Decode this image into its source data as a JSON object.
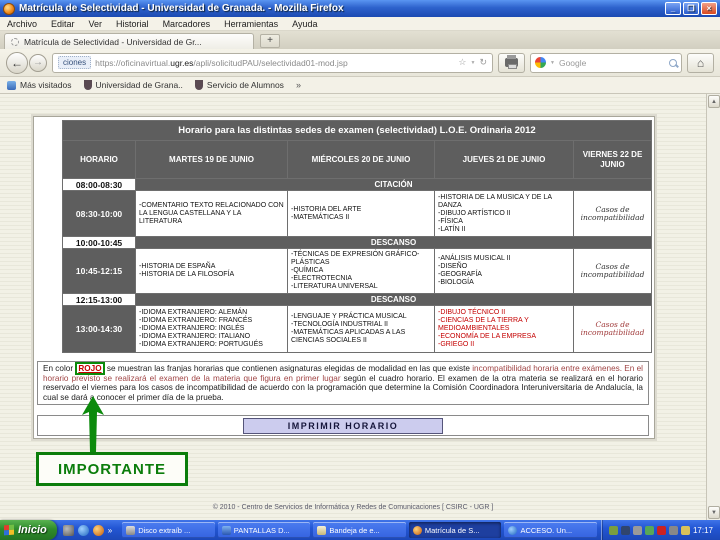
{
  "window": {
    "title": "Matrícula de Selectividad - Universidad de Granada. - Mozilla Firefox"
  },
  "menu": {
    "items": [
      "Archivo",
      "Editar",
      "Ver",
      "Historial",
      "Marcadores",
      "Herramientas",
      "Ayuda"
    ]
  },
  "tab": {
    "title": "Matrícula de Selectividad - Universidad de Gr..."
  },
  "nav": {
    "identity": "ciones",
    "url_prefix": "https://oficinavirtual.",
    "url_domain": "ugr.es",
    "url_path": "/apli/solicitudPAU/selectividad01-mod.jsp",
    "search_placeholder": "Google"
  },
  "bookmarks": {
    "items": [
      "Más visitados",
      "Universidad de Grana..",
      "Servicio de Alumnos"
    ]
  },
  "icons": {
    "back": "←",
    "forward": "→",
    "reload": "↻",
    "star": "☆",
    "caret": "▼",
    "home": "⌂",
    "new_tab": "+",
    "overflow": "»",
    "minimize": "_",
    "restore": "❐",
    "close": "×",
    "scroll_up": "▲",
    "scroll_down": "▼"
  },
  "schedule": {
    "title": "Horario para las distintas sedes de examen (selectividad) L.O.E. Ordinaria 2012",
    "headers": [
      "HORARIO",
      "MARTES 19 DE JUNIO",
      "MIÉRCOLES 20 DE JUNIO",
      "JUEVES 21 DE JUNIO",
      "VIERNES 22 DE JUNIO"
    ],
    "citacion": {
      "time": "08:00-08:30",
      "label": "CITACIÓN"
    },
    "slot1": {
      "time": "08:30-10:00",
      "martes": "-COMENTARIO TEXTO RELACIONADO CON LA LENGUA CASTELLANA Y LA LITERATURA",
      "miercoles": "-HISTORIA DEL ARTE\n-MATEMÁTICAS II",
      "jueves": "-HISTORIA DE LA MUSICA Y DE LA DANZA\n-DIBUJO ARTÍSTICO II\n-FÍSICA\n-LATÍN II",
      "viernes": "Casos de\nincompatibilidad"
    },
    "descanso1": {
      "time": "10:00-10:45",
      "label": "DESCANSO"
    },
    "slot2": {
      "time": "10:45-12:15",
      "martes": "-HISTORIA DE ESPAÑA\n-HISTORIA DE LA FILOSOFÍA",
      "miercoles": "-TÉCNICAS DE EXPRESIÓN GRÁFICO-PLÁSTICAS\n-QUÍMICA\n-ELECTROTECNIA\n-LITERATURA UNIVERSAL",
      "jueves": "-ANÁLISIS MUSICAL II\n-DISEÑO\n-GEOGRAFÍA\n-BIOLOGÍA",
      "viernes": "Casos de\nincompatibilidad"
    },
    "descanso2": {
      "time": "12:15-13:00",
      "label": "DESCANSO"
    },
    "slot3": {
      "time": "13:00-14:30",
      "martes": "-IDIOMA EXTRANJERO: ALEMÁN\n-IDIOMA EXTRANJERO: FRANCÉS\n-IDIOMA EXTRANJERO: INGLÉS\n-IDIOMA EXTRANJERO: ITALIANO\n-IDIOMA EXTRANJERO: PORTUGUÉS",
      "miercoles": "-LENGUAJE Y PRÁCTICA MUSICAL\n-TECNOLOGÍA INDUSTRIAL II\n-MATEMÁTICAS APLICADAS A LAS CIENCIAS SOCIALES II",
      "jueves": "-DIBUJO TÉCNICO II\n-CIENCIAS DE LA TIERRA Y MEDIOAMBIENTALES\n-ECONOMÍA DE LA EMPRESA\n-GRIEGO II",
      "viernes": "Casos de\nincompatibilidad"
    }
  },
  "note": {
    "seg1": "En color ",
    "rojo": "ROJO",
    "seg2": " se muestran las franjas horarias que contienen asignaturas elegidas de modalidad en las que existe ",
    "seg3": "incompatibilidad horaria entre exámenes. En el horario previsto se realizará el examen de la materia que figura en primer lugar ",
    "seg4": "según el cuadro horario. El examen de la otra materia se realizará en el horario reservado el viernes para los casos de incompatibilidad de acuerdo con la programación que determine la Comisión Coordinadora Interuniversitaria de Andalucía, la cual se dará a conocer el primer día de la prueba."
  },
  "print_button": "IMPRIMIR HORARIO",
  "annotation": {
    "importante": "IMPORTANTE"
  },
  "footer": "© 2010 - Centro de Servicios de Informática y Redes de Comunicaciones [ CSIRC - UGR ]",
  "taskbar": {
    "start": "Inicio",
    "tasks": [
      "Disco extraíb ...",
      "PANTALLAS D...",
      "Bandeja de e...",
      "Matrícula de S...",
      "ACCESO. Un..."
    ],
    "clock": "17:17"
  },
  "colors": {
    "red": "#c40000",
    "green": "#0b7d0b",
    "header_gray": "#5e5e5e",
    "button_lavender": "#ccccee",
    "taskbar_blue": "#2356d4"
  }
}
